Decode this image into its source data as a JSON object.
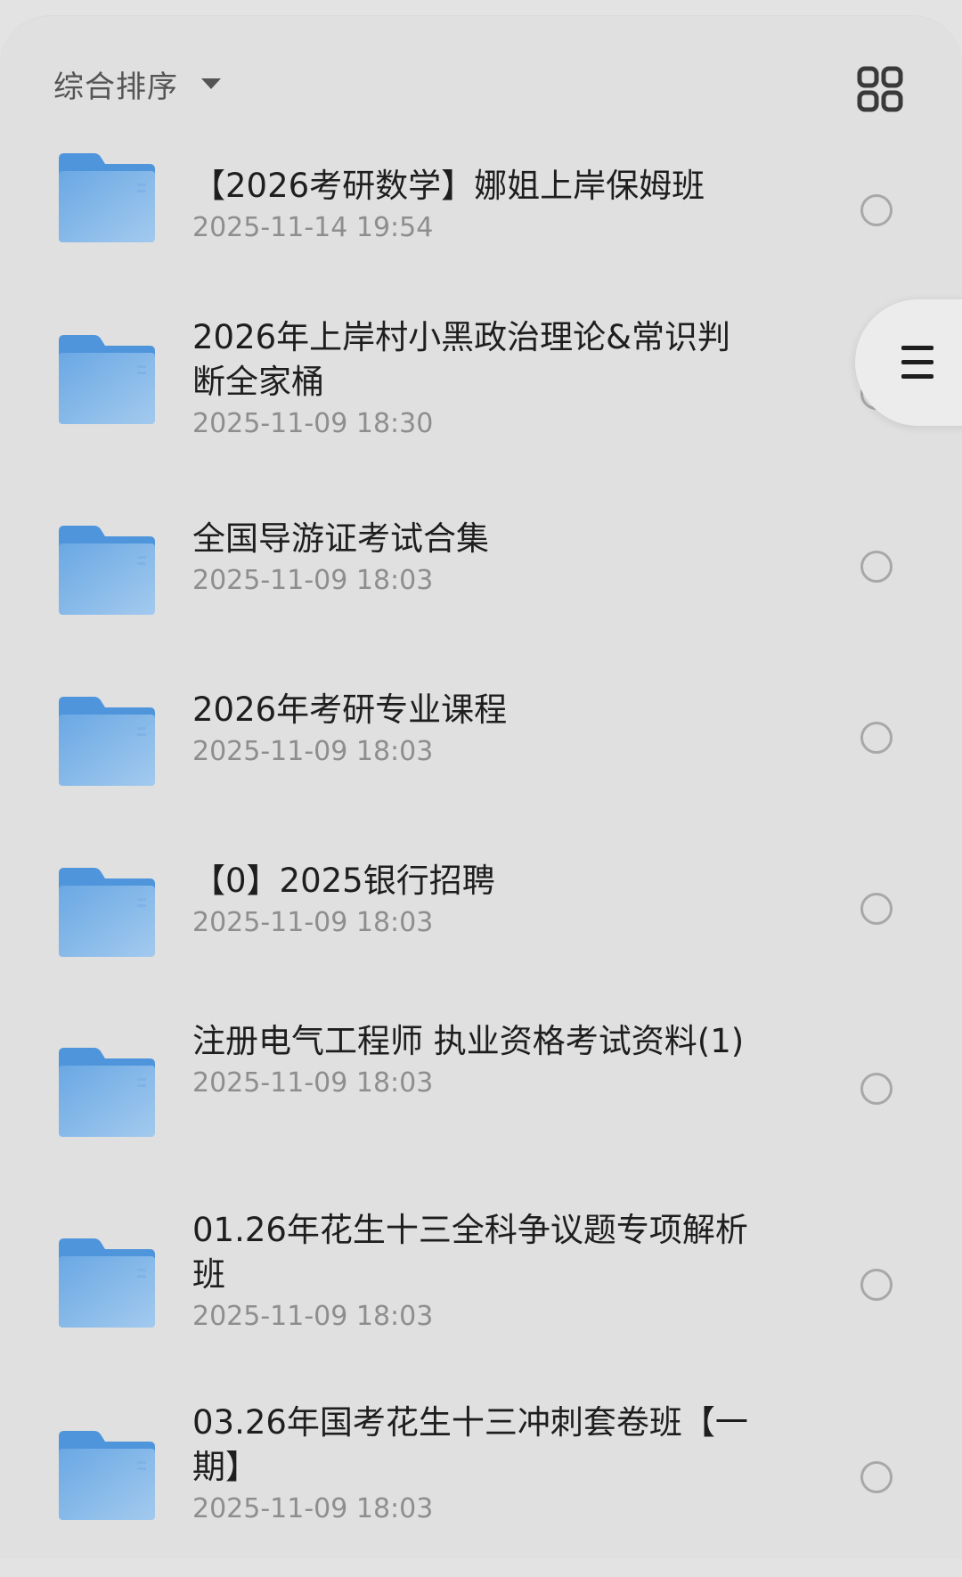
{
  "header": {
    "sort_label": "综合排序",
    "sort_icon": "caret-down-icon",
    "view_toggle_icon": "grid-view-icon"
  },
  "floating_menu": {
    "icon": "menu-icon"
  },
  "colors": {
    "folder": "#5b9fe0",
    "folder_light": "#9cc6ee",
    "text_primary": "#1e1e1e",
    "text_secondary": "#8e8e8e",
    "background": "#e0e0e0"
  },
  "files": [
    {
      "name": "【2026考研数学】娜姐上岸保姆班",
      "date": "2025-11-14 19:54"
    },
    {
      "name": "2026年上岸村小黑政治理论&常识判断全家桶",
      "date": "2025-11-09 18:30"
    },
    {
      "name": "全国导游证考试合集",
      "date": "2025-11-09 18:03"
    },
    {
      "name": "2026年考研专业课程",
      "date": "2025-11-09 18:03"
    },
    {
      "name": "【0】2025银行招聘",
      "date": "2025-11-09 18:03"
    },
    {
      "name": "注册电气工程师 执业资格考试资料(1)",
      "date": "2025-11-09 18:03"
    },
    {
      "name": "01.26年花生十三全科争议题专项解析班",
      "date": "2025-11-09 18:03"
    },
    {
      "name": "03.26年国考花生十三冲刺套卷班【一期】",
      "date": "2025-11-09 18:03"
    }
  ]
}
